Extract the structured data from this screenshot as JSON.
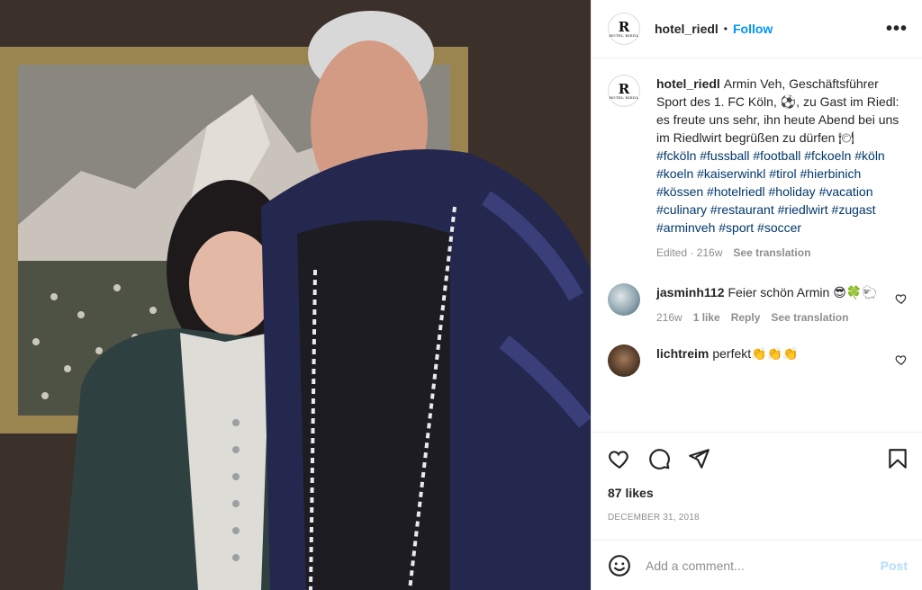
{
  "header": {
    "username": "hotel_riedl",
    "separator": "•",
    "follow_label": "Follow",
    "more_label": "•••",
    "avatar_letter": "R",
    "avatar_sub": "HOTEL RIEDL"
  },
  "caption": {
    "username": "hotel_riedl",
    "text": "Armin Veh, Geschäftsführer Sport des 1. FC Köln, ⚽, zu Gast im Riedl: es freute uns sehr, ihn heute Abend bei uns im Riedlwirt begrüßen zu dürfen 🍽",
    "hashtags": "#fcköln #fussball #football #fckoeln #köln #koeln #kaiserwinkl #tirol #hierbinich #kössen #hotelriedl #holiday #vacation #culinary #restaurant #riedlwirt #zugast #arminveh #sport #soccer",
    "meta": "Edited · 216w",
    "see_translation": "See translation"
  },
  "comments": [
    {
      "username": "jasminh112",
      "text": "Feier schön Armin 😎🍀🐑",
      "time": "216w",
      "likes": "1 like",
      "reply": "Reply",
      "see_translation": "See translation"
    },
    {
      "username": "lichtreim",
      "text": "perfekt👏👏👏"
    }
  ],
  "likes": "87 likes",
  "date": "DECEMBER 31, 2018",
  "add_comment": {
    "placeholder": "Add a comment...",
    "post_label": "Post"
  },
  "icons": [
    "heart-icon",
    "comment-icon",
    "share-icon",
    "bookmark-icon",
    "emoji-icon",
    "more-icon"
  ]
}
